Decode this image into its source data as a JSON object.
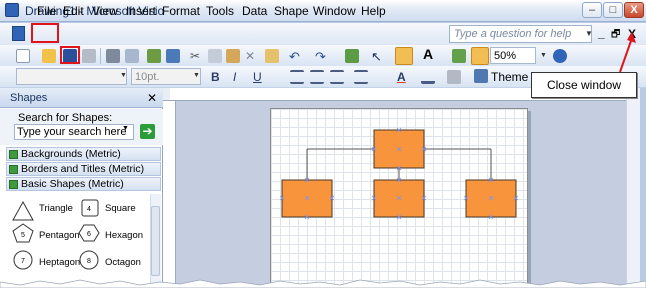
{
  "window": {
    "title": "Drawing1 - Microsoft Visio",
    "min_label": "–",
    "max_label": "□",
    "close_label": "X"
  },
  "menubar": {
    "items": [
      "File",
      "Edit",
      "View",
      "Insert",
      "Format",
      "Tools",
      "Data",
      "Shape",
      "Window",
      "Help"
    ],
    "help_placeholder": "Type a question for help",
    "doc_controls": {
      "minimize": "_",
      "restore": "🗗",
      "close": "X"
    }
  },
  "toolbar_standard": {
    "zoom": "50%"
  },
  "toolbar_format": {
    "font_size": "10pt.",
    "bold": "B",
    "italic": "I",
    "underline": "U",
    "theme": "Theme",
    "text_color_letter": "A"
  },
  "shapes_pane": {
    "title": "Shapes",
    "search_label": "Search for Shapes:",
    "search_placeholder": "Type your search here",
    "stencils": [
      "Backgrounds (Metric)",
      "Borders and Titles (Metric)",
      "Basic Shapes (Metric)"
    ],
    "shapes": [
      {
        "name": "Triangle"
      },
      {
        "name": "Square"
      },
      {
        "name": "Pentagon"
      },
      {
        "name": "Hexagon"
      },
      {
        "name": "Heptagon"
      },
      {
        "name": "Octagon"
      }
    ],
    "shape_glyphs": {
      "square": "4",
      "pentagon": "5",
      "hexagon": "6",
      "heptagon": "7",
      "octagon": "8"
    }
  },
  "callout": {
    "text": "Close window"
  },
  "colors": {
    "accent_box": "#f7943c",
    "highlight_red": "#e0141b",
    "handle": "#3b55d6"
  }
}
